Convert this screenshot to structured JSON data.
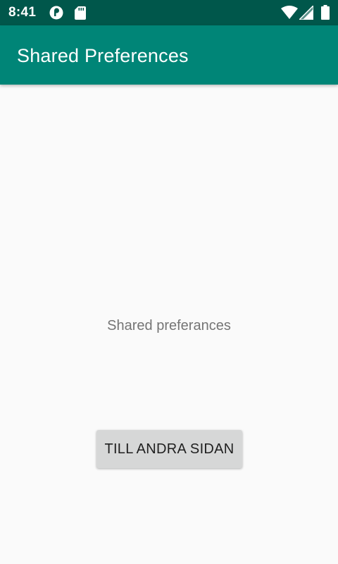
{
  "status_bar": {
    "time": "8:41",
    "left_icons": [
      "pocket-casts-icon",
      "sd-card-icon"
    ],
    "right_icons": [
      "wifi-icon",
      "cell-signal-icon",
      "battery-icon"
    ],
    "color": "#00574b"
  },
  "app_bar": {
    "title": "Shared Preferences",
    "color": "#008577"
  },
  "main": {
    "text": "Shared preferances",
    "button_label": "TILL ANDRA SIDAN"
  }
}
